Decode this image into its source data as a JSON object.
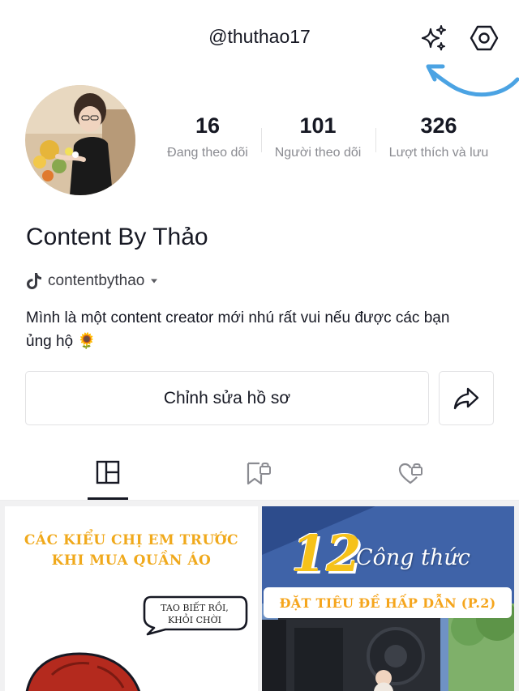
{
  "header": {
    "username": "@thuthao17",
    "icons": [
      "sparkle-icon",
      "settings-icon"
    ],
    "annotation_color": "#4ba3e3"
  },
  "profile": {
    "display_name": "Content By Thảo",
    "linked_account": "contentbythao",
    "bio_line1": "Mình là một content creator mới nhú rất vui nếu được các bạn",
    "bio_line2": "ủng hộ 🌻"
  },
  "stats": [
    {
      "value": "16",
      "label": "Đang theo dõi"
    },
    {
      "value": "101",
      "label": "Người theo dõi"
    },
    {
      "value": "326",
      "label": "Lượt thích và lưu"
    }
  ],
  "actions": {
    "edit_label": "Chỉnh sửa hồ sơ",
    "share_icon": "share-icon"
  },
  "tabs": [
    {
      "icon": "grid-icon",
      "active": true
    },
    {
      "icon": "saved-locked-icon",
      "active": false
    },
    {
      "icon": "liked-locked-icon",
      "active": false
    }
  ],
  "videos": [
    {
      "title_line1": "CÁC KIỂU CHỊ EM TRƯỚC",
      "title_line2": "KHI MUA QUẦN ÁO",
      "bubble_line1": "TAO BIẾT RỒI,",
      "bubble_line2": "KHỎI CHỜI"
    },
    {
      "number": "12",
      "word": "Công thức",
      "band": "ĐẶT TIÊU ĐỀ HẤP DẪN (P.2)"
    }
  ]
}
